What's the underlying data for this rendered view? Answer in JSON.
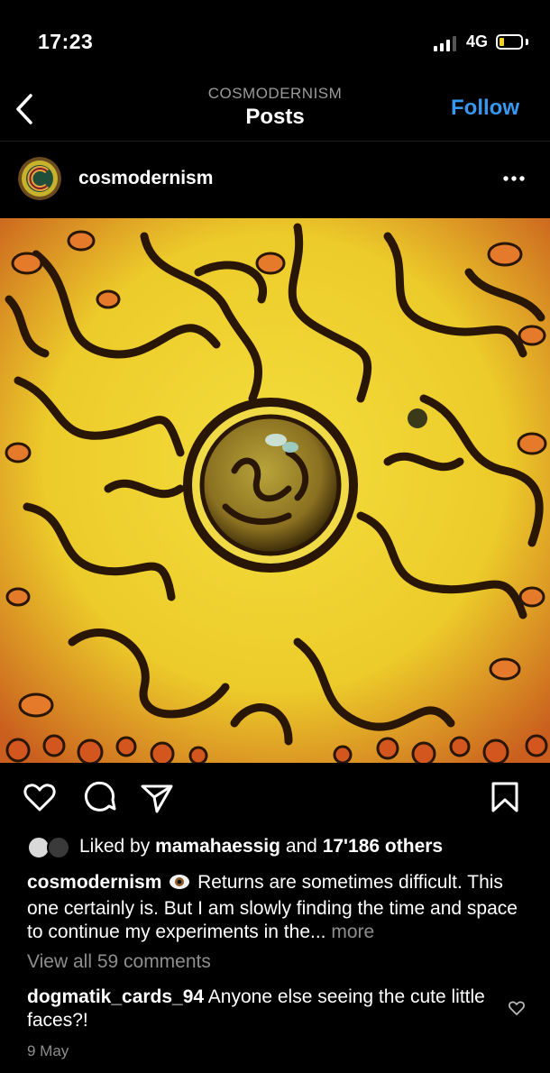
{
  "status_bar": {
    "time": "17:23",
    "network": "4G",
    "battery_level": 0.15
  },
  "nav": {
    "subtitle": "COSMODERNISM",
    "title": "Posts",
    "follow_label": "Follow"
  },
  "post": {
    "username": "cosmodernism",
    "liked_by_prefix": "Liked by ",
    "liked_by_user": "mamahaessig",
    "liked_by_and": " and ",
    "liked_by_others": "17'186 others",
    "caption_user": "cosmodernism",
    "caption_text": "Returns are sometimes difficult. This one certainly is. But I am slowly finding the time and space to continue my experiments in the...",
    "more_label": "more",
    "view_comments": "View all 59 comments",
    "comment_user": "dogmatik_cards_94",
    "comment_text": "Anyone else seeing the cute little faces?!",
    "date": "9 May"
  },
  "colors": {
    "accent": "#3897f0",
    "muted": "#8e8e8e",
    "image_yellow": "#f1d83b",
    "image_orange": "#e0702a"
  }
}
